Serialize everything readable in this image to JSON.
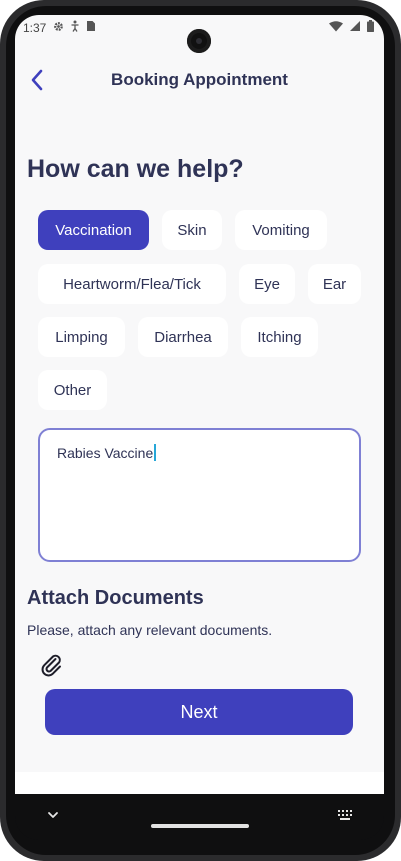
{
  "status_bar": {
    "time": "1:37",
    "left_icons": [
      "gear-icon",
      "accessibility-icon",
      "sim-card-icon"
    ],
    "right_icons": [
      "wifi-icon",
      "signal-icon",
      "battery-icon"
    ]
  },
  "header": {
    "title": "Booking Appointment",
    "back_icon": "chevron-left-icon"
  },
  "heading": "How can we help?",
  "chips": [
    {
      "label": "Vaccination",
      "selected": true
    },
    {
      "label": "Skin",
      "selected": false
    },
    {
      "label": "Vomiting",
      "selected": false
    },
    {
      "label": "Heartworm/Flea/Tick",
      "selected": false
    },
    {
      "label": "Eye",
      "selected": false
    },
    {
      "label": "Ear",
      "selected": false
    },
    {
      "label": "Limping",
      "selected": false
    },
    {
      "label": "Diarrhea",
      "selected": false
    },
    {
      "label": "Itching",
      "selected": false
    },
    {
      "label": "Other",
      "selected": false
    }
  ],
  "notes": {
    "value": "Rabies Vaccine"
  },
  "attach": {
    "title": "Attach Documents",
    "description": "Please, attach any relevant documents.",
    "icon": "paperclip-icon"
  },
  "next_button": {
    "label": "Next"
  },
  "colors": {
    "primary": "#3f40bd",
    "text_dark": "#2f3356",
    "background": "#f8f8f9",
    "border": "#7f80d4"
  },
  "nav_bar": {
    "icons": [
      "chevron-down-icon",
      "home-pill",
      "keyboard-icon"
    ]
  }
}
